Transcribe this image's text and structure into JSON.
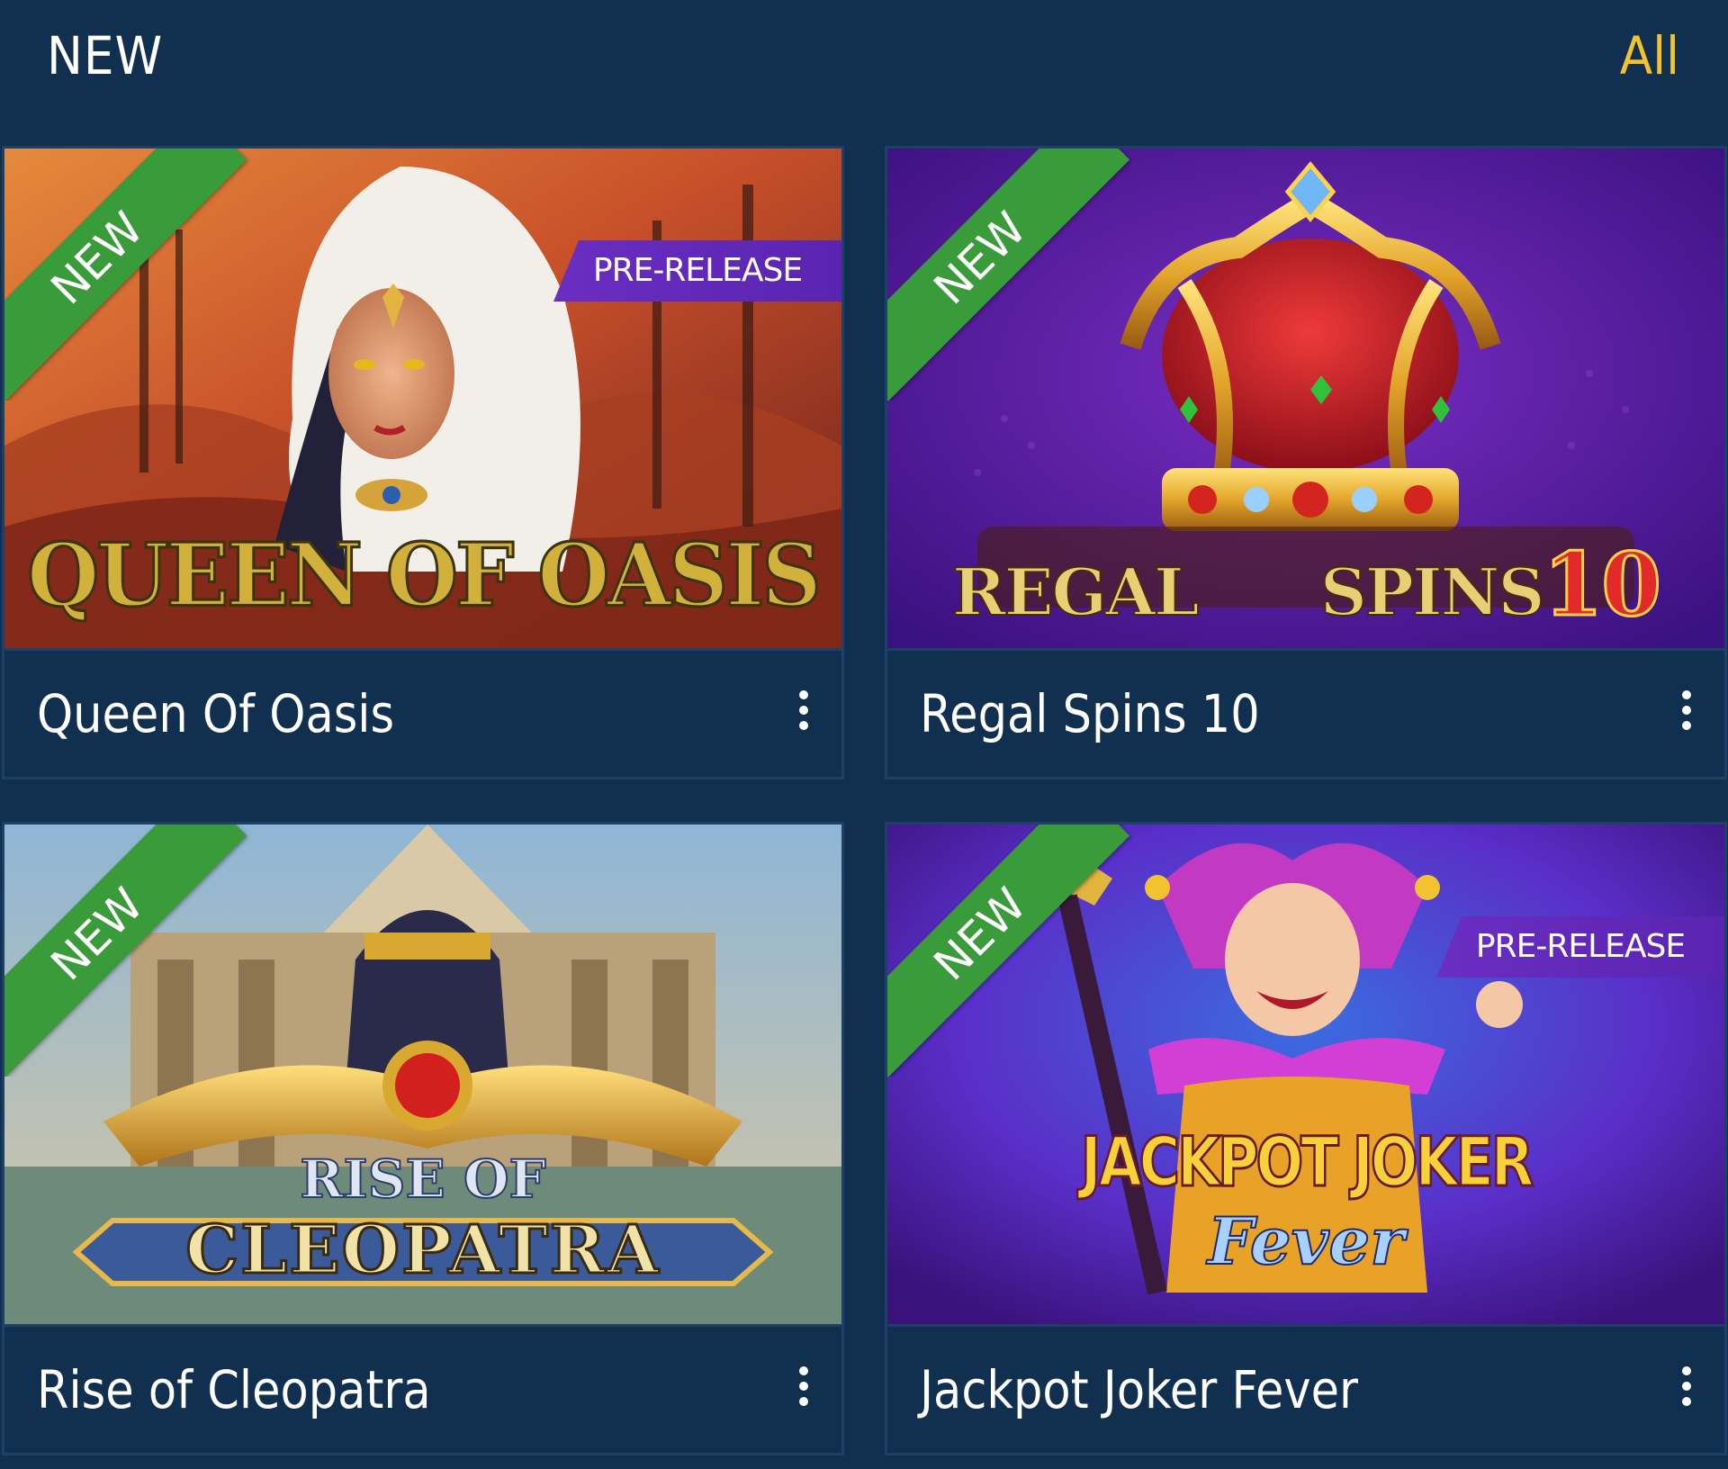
{
  "section": {
    "title": "NEW",
    "all_link": "All"
  },
  "games": [
    {
      "title": "Queen Of Oasis",
      "ribbon": "NEW",
      "badge": "PRE-RELEASE",
      "logo": "QUEEN OF OASIS",
      "menu_icon": "kebab-menu-icon"
    },
    {
      "title": "Regal Spins 10",
      "ribbon": "NEW",
      "badge": "",
      "logo_word1": "REGAL",
      "logo_word2": "SPINS",
      "logo_num": "10",
      "menu_icon": "kebab-menu-icon"
    },
    {
      "title": "Rise of Cleopatra",
      "ribbon": "NEW",
      "badge": "",
      "logo_line1": "RISE OF",
      "logo_line2": "CLEOPATRA",
      "menu_icon": "kebab-menu-icon"
    },
    {
      "title": "Jackpot Joker Fever",
      "ribbon": "NEW",
      "badge": "PRE-RELEASE",
      "logo_line1": "JACKPOT JOKER",
      "logo_line2": "Fever",
      "menu_icon": "kebab-menu-icon"
    }
  ],
  "colors": {
    "background": "#11304f",
    "accent": "#f2c230",
    "ribbon": "#3a9b3a",
    "badge": "#6a2ec2"
  }
}
